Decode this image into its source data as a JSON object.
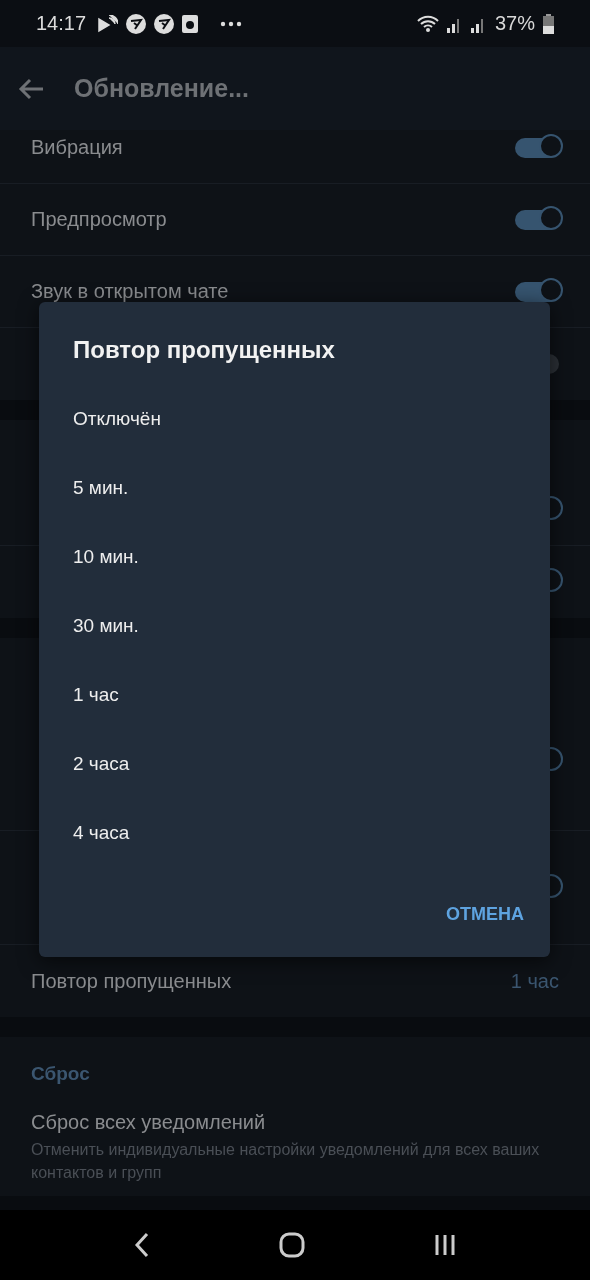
{
  "status_bar": {
    "time": "14:17",
    "battery": "37%"
  },
  "app_bar": {
    "title": "Обновление..."
  },
  "sections": [
    {
      "kind": "plain",
      "rows": [
        {
          "kind": "toggle",
          "title": "Вибрация",
          "on": true
        },
        {
          "kind": "toggle",
          "title": "Предпросмотр",
          "on": true
        },
        {
          "kind": "toggle",
          "title": "Звук в открытом чате",
          "on": true
        },
        {
          "kind": "toggle",
          "on": false
        }
      ]
    },
    {
      "kind": "titled",
      "rows": [
        {
          "kind": "toggle",
          "on": true
        },
        {
          "kind": "toggle",
          "on": true
        }
      ]
    },
    {
      "kind": "titled",
      "rows": [
        {
          "kind": "tall",
          "on": true
        },
        {
          "kind": "medium",
          "on": true
        },
        {
          "kind": "value",
          "title": "Повтор пропущенных",
          "value": "1 час"
        }
      ]
    },
    {
      "kind": "titled",
      "header": "Сброс",
      "rows": [
        {
          "kind": "action",
          "title": "Сброс всех уведомлений",
          "subtitle": "Отменить индивидуальные настройки уведомлений для всех ваших контактов и групп"
        }
      ]
    }
  ],
  "dialog": {
    "title": "Повтор пропущенных",
    "options": [
      "Отключён",
      "5 мин.",
      "10 мин.",
      "30 мин.",
      "1 час",
      "2 часа",
      "4 часа"
    ],
    "cancel": "ОТМЕНА"
  }
}
